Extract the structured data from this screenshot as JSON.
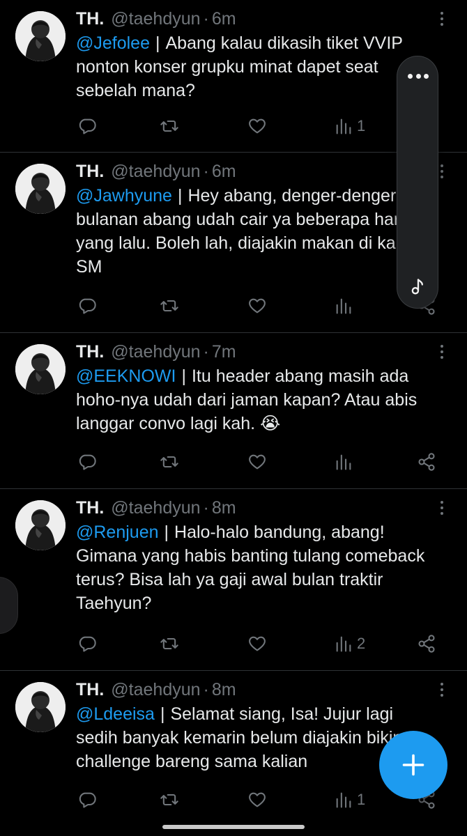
{
  "tweets": [
    {
      "name": "TH.",
      "handle": "@taehdyun",
      "dot": "·",
      "time": "6m",
      "mention": "@Jefolee",
      "separator": "|",
      "body": "Abang kalau dikasih tiket VVIP nonton konser grupku minat dapet seat sebelah mana?",
      "views": "1"
    },
    {
      "name": "TH.",
      "handle": "@taehdyun",
      "dot": "·",
      "time": "6m",
      "mention": "@Jawhyune",
      "separator": "|",
      "body": "Hey abang, denger-denger bulanan abang udah cair ya beberapa hari yang lalu. Boleh lah, diajakin makan di kantin SM",
      "views": ""
    },
    {
      "name": "TH.",
      "handle": "@taehdyun",
      "dot": "·",
      "time": "7m",
      "mention": "@EEKNOWI",
      "separator": "|",
      "body": "Itu header abang masih ada hoho-nya udah dari jaman kapan? Atau abis langgar convo lagi kah. 😭",
      "views": ""
    },
    {
      "name": "TH.",
      "handle": "@taehdyun",
      "dot": "·",
      "time": "8m",
      "mention": "@Renjuen",
      "separator": "|",
      "body": "Halo-halo bandung, abang! Gimana yang habis banting tulang comeback terus? Bisa lah ya gaji awal bulan traktir Taehyun?",
      "views": "2"
    },
    {
      "name": "TH.",
      "handle": "@taehdyun",
      "dot": "·",
      "time": "8m",
      "mention": "@Ldeeisa",
      "separator": "|",
      "body": "Selamat siang, Isa! Jujur lagi sedih banyak kemarin belum diajakin bikin challenge bareng sama kalian",
      "views": "1"
    }
  ],
  "icons": {
    "reply": "reply-icon",
    "retweet": "retweet-icon",
    "like": "like-icon",
    "views": "views-icon",
    "share": "share-icon",
    "more": "more-options-icon",
    "compose": "compose-plus-icon",
    "panel_menu": "panel-menu-icon",
    "panel_music": "music-note-icon"
  },
  "colors": {
    "background": "#000000",
    "text": "#e7e9ea",
    "muted": "#71767b",
    "mention": "#1d9bf0",
    "fab": "#1d9bf0",
    "divider": "#2f3336"
  }
}
